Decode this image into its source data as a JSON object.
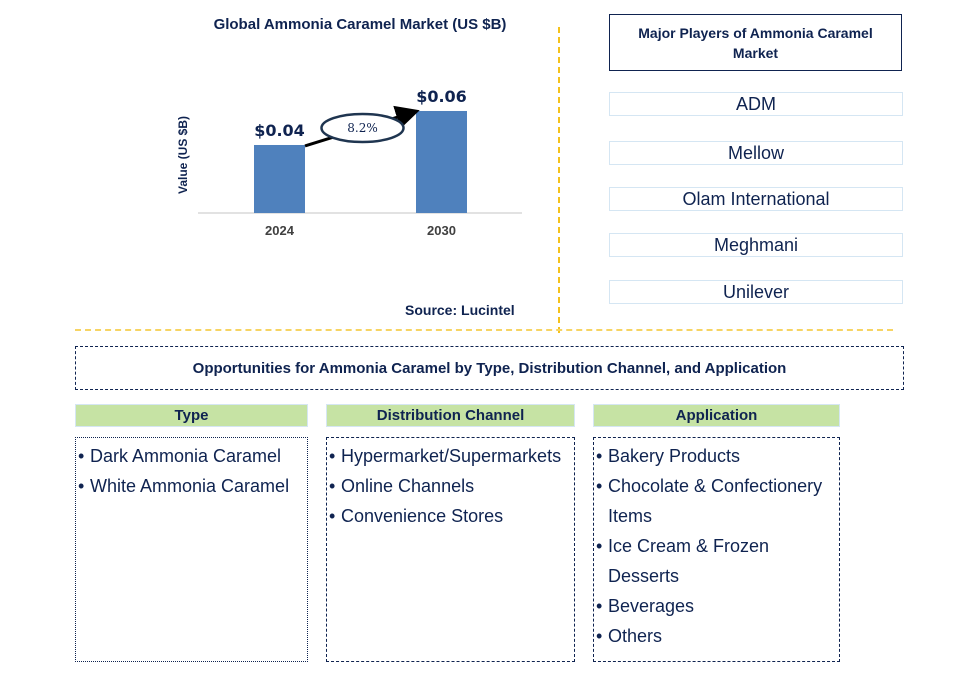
{
  "chart_data": {
    "type": "bar",
    "title": "Global Ammonia Caramel Market (US $B)",
    "xlabel": "",
    "ylabel": "Value (US $B)",
    "categories": [
      "2024",
      "2030"
    ],
    "values": [
      0.04,
      0.06
    ],
    "data_labels": [
      "$0.04",
      "$0.06"
    ],
    "ylim": [
      0,
      0.07
    ],
    "grid": false,
    "bar_color": "#4f81bd",
    "annotation": {
      "type": "cagr-arrow",
      "label": "8.2%",
      "from": "2024",
      "to": "2030"
    }
  },
  "source": "Source: Lucintel",
  "players": {
    "title": "Major Players of Ammonia Caramel Market",
    "items": [
      "ADM",
      "Mellow",
      "Olam International",
      "Meghmani",
      "Unilever"
    ]
  },
  "opportunities": {
    "title": "Opportunities for Ammonia Caramel by Type, Distribution Channel, and Application",
    "categories": [
      {
        "header": "Type",
        "items": [
          [
            "Dark Ammonia Caramel"
          ],
          [
            "White Ammonia Caramel"
          ]
        ]
      },
      {
        "header": "Distribution Channel",
        "items": [
          [
            "Hypermarket/Supermarkets"
          ],
          [
            "Online Channels"
          ],
          [
            "Convenience Stores"
          ]
        ]
      },
      {
        "header": "Application",
        "items": [
          [
            "Bakery Products"
          ],
          [
            "Chocolate & Confectionery",
            "Items"
          ],
          [
            "Ice Cream & Frozen",
            "Desserts"
          ],
          [
            "Beverages"
          ],
          [
            "Others"
          ]
        ]
      }
    ]
  },
  "colors": {
    "text": "#0f2350",
    "accent_header": "#c6e3a4",
    "divider": "#f5c21b",
    "player_border": "#d5e6f3"
  }
}
